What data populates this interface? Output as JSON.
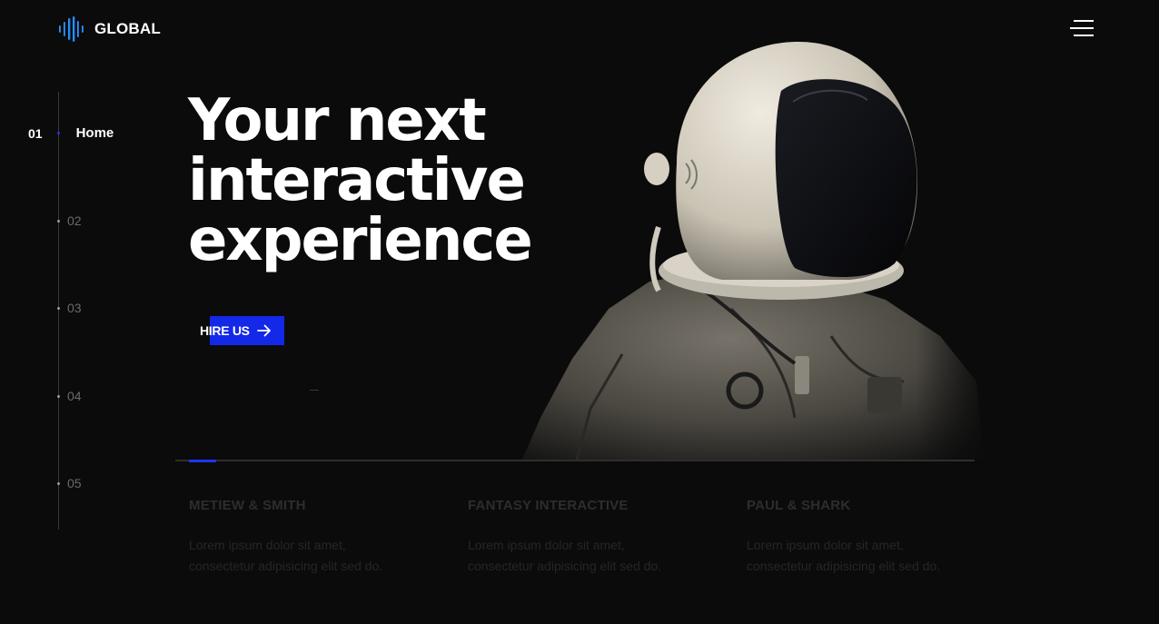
{
  "brand": {
    "name": "GLOBAL",
    "logo_icon": "audio-wave-logo-icon",
    "accent": "#1428e8"
  },
  "menu": {
    "icon": "hamburger-menu-icon"
  },
  "side_nav": [
    {
      "number": "01",
      "label": "Home",
      "active": true
    },
    {
      "number": "02",
      "label": "",
      "active": false
    },
    {
      "number": "03",
      "label": "",
      "active": false
    },
    {
      "number": "04",
      "label": "",
      "active": false
    },
    {
      "number": "05",
      "label": "",
      "active": false
    }
  ],
  "hero": {
    "title_lines": [
      "Your next",
      "interactive",
      "experience"
    ],
    "cta_label": "HIRE US",
    "cta_icon": "arrow-right-icon"
  },
  "slider": {
    "progress": 0.034,
    "cards": [
      {
        "title": "METIEW & SMITH",
        "text_line1": "Lorem ipsum dolor sit amet,",
        "text_line2": "consectetur adipisicing elit sed do."
      },
      {
        "title": "FANTASY INTERACTIVE",
        "text_line1": "Lorem ipsum dolor sit amet,",
        "text_line2": "consectetur adipisicing elit sed do."
      },
      {
        "title": "PAUL & SHARK",
        "text_line1": "Lorem ipsum dolor sit amet,",
        "text_line2": "consectetur adipisicing elit sed do."
      }
    ]
  }
}
